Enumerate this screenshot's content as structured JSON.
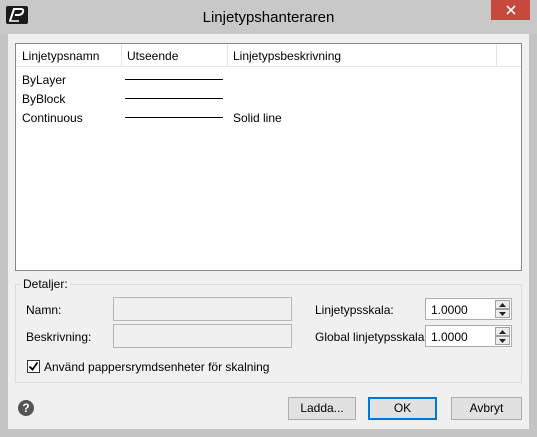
{
  "window": {
    "title": "Linjetypshanteraren"
  },
  "list": {
    "columns": [
      "Linjetypsnamn",
      "Utseende",
      "Linjetypsbeskrivning"
    ],
    "rows": [
      {
        "name": "ByLayer",
        "description": ""
      },
      {
        "name": "ByBlock",
        "description": ""
      },
      {
        "name": "Continuous",
        "description": "Solid line"
      }
    ]
  },
  "details": {
    "title": "Detaljer:",
    "name_label": "Namn:",
    "name_value": "",
    "description_label": "Beskrivning:",
    "description_value": "",
    "linetype_scale_label": "Linjetypsskala:",
    "linetype_scale_value": "1.0000",
    "global_scale_label": "Global linjetypsskala:",
    "global_scale_value": "1.0000",
    "paperspace_label": "Använd pappersrymdsenheter för skalning",
    "paperspace_checked": true
  },
  "buttons": {
    "load": "Ladda...",
    "ok": "OK",
    "cancel": "Avbryt",
    "help": "?"
  },
  "colors": {
    "close_button": "#c7483d",
    "default_border": "#0078d7"
  }
}
